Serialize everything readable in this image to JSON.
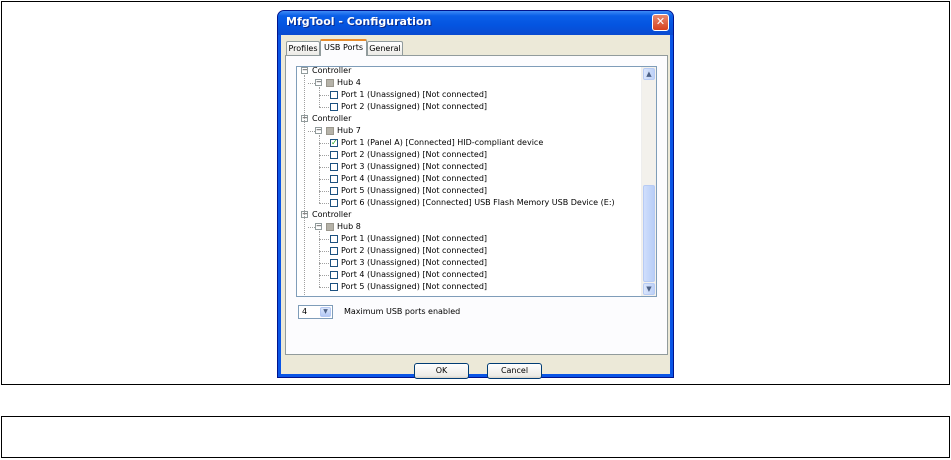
{
  "window": {
    "title": "MfgTool - Configuration",
    "close_glyph": "✕"
  },
  "tabs": [
    {
      "label": "Profiles",
      "active": false
    },
    {
      "label": "USB Ports",
      "active": true
    },
    {
      "label": "General",
      "active": false
    }
  ],
  "tree": {
    "controllers": [
      {
        "label": "Controller",
        "hub": {
          "label": "Hub 4",
          "ports": [
            {
              "label": "Port 1 (Unassigned) [Not connected]",
              "checked": false
            },
            {
              "label": "Port 2 (Unassigned) [Not connected]",
              "checked": false
            }
          ]
        }
      },
      {
        "label": "Controller",
        "hub": {
          "label": "Hub 7",
          "ports": [
            {
              "label": "Port 1 (Panel A) [Connected] HID-compliant device",
              "checked": true
            },
            {
              "label": "Port 2 (Unassigned) [Not connected]",
              "checked": false
            },
            {
              "label": "Port 3 (Unassigned) [Not connected]",
              "checked": false
            },
            {
              "label": "Port 4 (Unassigned) [Not connected]",
              "checked": false
            },
            {
              "label": "Port 5 (Unassigned) [Not connected]",
              "checked": false
            },
            {
              "label": "Port 6 (Unassigned) [Connected] USB Flash Memory USB Device (E:)",
              "checked": false
            }
          ]
        }
      },
      {
        "label": "Controller",
        "hub": {
          "label": "Hub 8",
          "ports": [
            {
              "label": "Port 1 (Unassigned) [Not connected]",
              "checked": false
            },
            {
              "label": "Port 2 (Unassigned) [Not connected]",
              "checked": false
            },
            {
              "label": "Port 3 (Unassigned) [Not connected]",
              "checked": false
            },
            {
              "label": "Port 4 (Unassigned) [Not connected]",
              "checked": false
            },
            {
              "label": "Port 5 (Unassigned) [Not connected]",
              "checked": false
            }
          ]
        }
      }
    ]
  },
  "max_ports": {
    "value": "4",
    "label": "Maximum USB ports enabled"
  },
  "buttons": {
    "ok": "OK",
    "cancel": "Cancel"
  },
  "icons": {
    "expander": "minus-expander-icon",
    "hub": "hub-icon",
    "check": "checkmark-icon",
    "scroll_up": "chevron-up-icon",
    "scroll_down": "chevron-down-icon",
    "dropdown": "chevron-down-icon"
  }
}
